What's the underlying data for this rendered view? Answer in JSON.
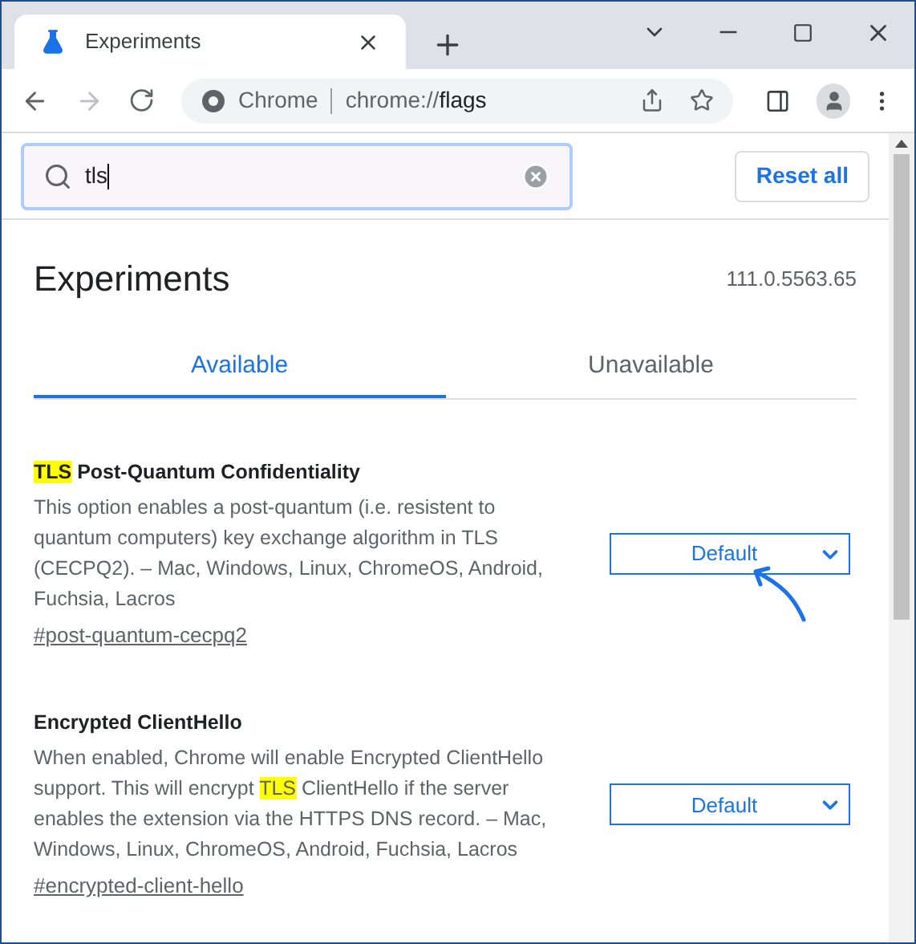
{
  "tab": {
    "title": "Experiments",
    "selected": true
  },
  "omnibox": {
    "site": "Chrome",
    "url_prefix": "chrome://",
    "url_path": "flags"
  },
  "search": {
    "value": "tls"
  },
  "reset_button": "Reset all",
  "heading": "Experiments",
  "version": "111.0.5563.65",
  "tabs": [
    {
      "label": "Available",
      "selected": true
    },
    {
      "label": "Unavailable",
      "selected": false
    }
  ],
  "flags": [
    {
      "title": [
        {
          "text": "TLS",
          "highlight": true
        },
        {
          "text": " Post-Quantum Confidentiality",
          "highlight": false
        }
      ],
      "description": [
        {
          "text": "This option enables a post-quantum (i.e. resistent to quantum computers) key exchange algorithm in TLS (CECPQ2). – Mac, Windows, Linux, ChromeOS, Android, Fuchsia, Lacros",
          "highlight": false
        }
      ],
      "link": "#post-quantum-cecpq2",
      "value": "Default",
      "annotated": true
    },
    {
      "title": [
        {
          "text": "Encrypted ClientHello",
          "highlight": false
        }
      ],
      "description": [
        {
          "text": "When enabled, Chrome will enable Encrypted ClientHello support. This will encrypt ",
          "highlight": false
        },
        {
          "text": "TLS",
          "highlight": true
        },
        {
          "text": " ClientHello if the server enables the extension via the HTTPS DNS record. – Mac, Windows, Linux, ChromeOS, Android, Fuchsia, Lacros",
          "highlight": false
        }
      ],
      "link": "#encrypted-client-hello",
      "value": "Default",
      "annotated": false
    }
  ]
}
